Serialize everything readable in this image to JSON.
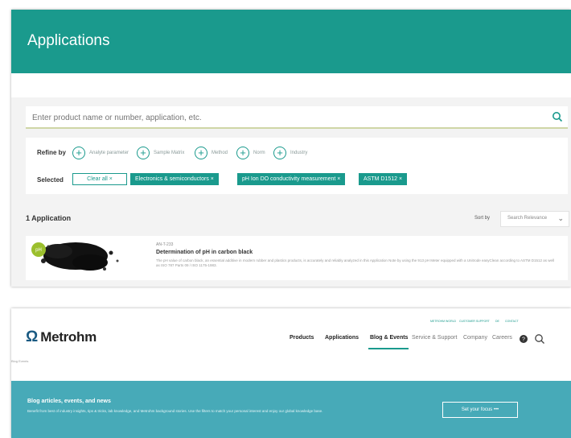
{
  "applications": {
    "title": "Applications",
    "search": {
      "placeholder": "Enter product name or number, application, etc."
    },
    "refine": {
      "label": "Refine by",
      "options": [
        "Analyte parameter",
        "Sample Matrix",
        "Method",
        "Norm",
        "Industry"
      ]
    },
    "selected": {
      "label": "Selected",
      "clear_all": "Clear all ×",
      "chips": [
        "Electronics & semiconductors ×",
        "pH Ion DO conductivity measurement ×",
        "ASTM D1512 ×"
      ]
    },
    "results": {
      "count": "1 Application",
      "sort_label": "Sort by",
      "sort_value": "Search Relevance"
    },
    "card": {
      "badge": "pH",
      "meta": "AN-T-233",
      "title": "Determination of pH in carbon black",
      "description": "The pH value of carbon black, an essential additive in modern rubber and plastics products, is accurately and reliably analyzed in this Application Note by using the 913 pH Meter equipped with a Unitrode easyClean according to ASTM D1512 as well as ISO 787 Parts 09 / ISO 1175-1983."
    }
  },
  "metrohm": {
    "top_links": [
      "METROHM WORLD",
      "CUSTOMER SUPPORT",
      "DE",
      "CONTACT"
    ],
    "logo_text": "Metrohm",
    "nav": {
      "products": "Products",
      "applications": "Applications",
      "blog_events": "Blog & Events",
      "service_support": "Service & Support",
      "company": "Company",
      "careers": "Careers"
    },
    "icons": [
      "help-icon",
      "search-icon"
    ],
    "breadcrumb": "Blog Events",
    "hero": {
      "title": "Blog articles, events, and news",
      "description": "Benefit from best of industry insights, tips & tricks, lab knowledge, and Metrohm background stories. Use the filters to match your personal interest and enjoy our global knowledge base.",
      "button": "Set your focus •••"
    }
  },
  "colors": {
    "teal": "#1a9a8d",
    "hero_blue": "#47aab8",
    "logo_blue": "#1a5a82"
  }
}
